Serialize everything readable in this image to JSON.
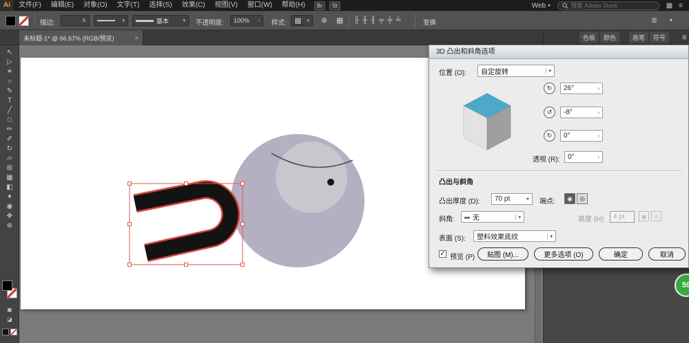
{
  "menubar": {
    "logo": "Ai",
    "items": [
      {
        "name": "menu-file",
        "label": "文件(F)"
      },
      {
        "name": "menu-edit",
        "label": "编辑(E)"
      },
      {
        "name": "menu-object",
        "label": "对象(O)"
      },
      {
        "name": "menu-type",
        "label": "文字(T)"
      },
      {
        "name": "menu-select",
        "label": "选择(S)"
      },
      {
        "name": "menu-effect",
        "label": "效果(C)"
      },
      {
        "name": "menu-view",
        "label": "视图(V)"
      },
      {
        "name": "menu-window",
        "label": "窗口(W)"
      },
      {
        "name": "menu-help",
        "label": "帮助(H)"
      }
    ],
    "bridge_label": "Br",
    "stock_label": "St",
    "workspace_label": "Web",
    "search_placeholder": "搜索 Adobe Stock"
  },
  "controlbar": {
    "stroke_label": "描边:",
    "basic_label": "基本",
    "opacity_label": "不透明度:",
    "opacity_value": "100%",
    "style_label": "样式:",
    "transform_label": "变换",
    "align_icons": [
      {
        "name": "align-left-icon",
        "glyph": "╟"
      },
      {
        "name": "align-center-h-icon",
        "glyph": "╫"
      },
      {
        "name": "align-right-icon",
        "glyph": "╢"
      },
      {
        "name": "align-top-icon",
        "glyph": "╤"
      },
      {
        "name": "align-middle-icon",
        "glyph": "╪"
      },
      {
        "name": "align-bottom-icon",
        "glyph": "╧"
      }
    ]
  },
  "doc_tab": {
    "title": "未标题-1* @ 66.67% (RGB/预览)",
    "close_glyph": "×"
  },
  "tools": [
    {
      "name": "selection-tool",
      "glyph": "↖"
    },
    {
      "name": "direct-selection-tool",
      "glyph": "▷"
    },
    {
      "name": "magic-wand-tool",
      "glyph": "✶"
    },
    {
      "name": "lasso-tool",
      "glyph": "○"
    },
    {
      "name": "pen-tool",
      "glyph": "✎"
    },
    {
      "name": "type-tool",
      "glyph": "T"
    },
    {
      "name": "line-segment-tool",
      "glyph": "╱"
    },
    {
      "name": "rectangle-tool",
      "glyph": "□"
    },
    {
      "name": "paintbrush-tool",
      "glyph": "✏"
    },
    {
      "name": "pencil-tool",
      "glyph": "✐"
    },
    {
      "name": "rotate-tool",
      "glyph": "↻"
    },
    {
      "name": "scale-tool",
      "glyph": "▱"
    },
    {
      "name": "shape-builder-tool",
      "glyph": "⊞"
    },
    {
      "name": "mesh-tool",
      "glyph": "▦"
    },
    {
      "name": "gradient-tool",
      "glyph": "◧"
    },
    {
      "name": "eyedropper-tool",
      "glyph": "✦"
    },
    {
      "name": "blend-tool",
      "glyph": "◉"
    },
    {
      "name": "hand-tool",
      "glyph": "✥"
    },
    {
      "name": "zoom-tool",
      "glyph": "⊕"
    }
  ],
  "dialog": {
    "title": "3D 凸出和斜角选项",
    "position_label": "位置 (O):",
    "position_value": "自定旋转",
    "rotate_x": "26°",
    "rotate_y": "-8°",
    "rotate_z": "0°",
    "perspective_label": "透视 (R):",
    "perspective_value": "0°",
    "section_extrude": "凸出与斜角",
    "depth_label": "凸出厚度 (D):",
    "depth_value": "70 pt",
    "caps_label": "端点:",
    "bevel_label": "斜角:",
    "bevel_value": "无",
    "height_label": "高度 (H):",
    "height_value": "4 pt",
    "surface_label": "表面 (S):",
    "surface_value": "塑料效果底纹",
    "preview_label": "预览 (P)",
    "map_button": "贴图 (M)...",
    "more_button": "更多选项 (O)",
    "ok_button": "确定",
    "cancel_button": "取消"
  },
  "right_dock": {
    "tabs_group1": [
      "色板",
      "颜色"
    ],
    "tabs_group2": [
      "画笔",
      "符号"
    ],
    "badge_count": "59"
  },
  "glyphs": {
    "chevron_down": "▾",
    "chevron_right": "›",
    "check": "✓",
    "cap_solid": "◉",
    "cap_hollow": "◎",
    "rotate_x": "↻",
    "rotate_y": "↺",
    "rotate_z": "↻",
    "panel_menu": "≣",
    "grid": "▦",
    "hamburger": "≡",
    "globe": "⊕"
  },
  "colors": {
    "cube_top": "#4ea9c9",
    "selection_red": "#e2564e",
    "head_purple": "#b5afc2",
    "badge_green": "#3aa93f"
  }
}
